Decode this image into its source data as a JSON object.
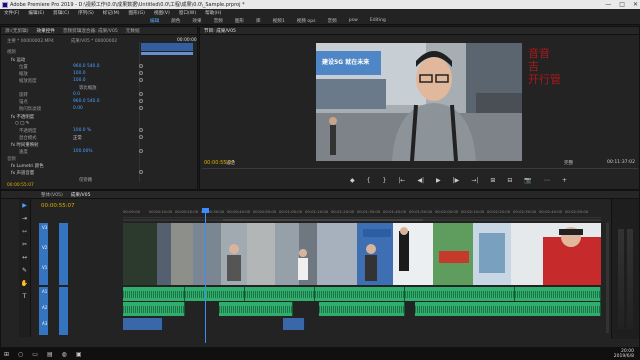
{
  "window": {
    "title": "Adobe Premiere Pro 2019 - D:\\视频工作\\0.0\\成果数据\\Untitled\\0.0\\工程\\成果\\0.0\\_Sample.prproj *",
    "controls": [
      "—",
      "□",
      "✕"
    ]
  },
  "menu": [
    "文件(F)",
    "编辑(E)",
    "剪辑(C)",
    "序列(S)",
    "标记(M)",
    "图形(G)",
    "视图(V)",
    "窗口(W)",
    "帮助(H)"
  ],
  "workspaces": {
    "items": [
      "编辑",
      "颜色",
      "效果",
      "音频",
      "图形",
      "库",
      "视频1",
      "视频 ops",
      "音频",
      "psw",
      "Editing"
    ],
    "active": "编辑"
  },
  "effect_controls": {
    "tabs": [
      "源:(无剪辑)",
      "效果控件",
      "音频剪辑混合器: 成果/V05",
      "元数据"
    ],
    "clip_label": "主要 * 00000002.MP4",
    "seq_label": "成果/V05 * 00000002",
    "timecode": "00:00:00",
    "rows": [
      {
        "label": "视频",
        "value": ""
      },
      {
        "label": "fx 运动",
        "value": ""
      },
      {
        "label": "位置",
        "value": "960.0   540.0"
      },
      {
        "label": "缩放",
        "value": "100.0"
      },
      {
        "label": "缩放宽度",
        "value": "100.0"
      },
      {
        "label": "",
        "value": "等比缩放"
      },
      {
        "label": "旋转",
        "value": "0.0"
      },
      {
        "label": "锚点",
        "value": "960.0   540.0"
      },
      {
        "label": "防闪烁滤镜",
        "value": "0.00"
      },
      {
        "label": "fx 不透明度",
        "value": ""
      },
      {
        "label": "",
        "value": ""
      },
      {
        "label": "不透明度",
        "value": "100.0 %"
      },
      {
        "label": "混合模式",
        "value": "正常"
      },
      {
        "label": "fx 时间重映射",
        "value": ""
      },
      {
        "label": "速度",
        "value": "100.00%"
      },
      {
        "label": "音频",
        "value": ""
      },
      {
        "label": "fx Lumetri 颜色",
        "value": ""
      },
      {
        "label": "fx 声道音量",
        "value": ""
      },
      {
        "label": "",
        "value": "仅旁路"
      }
    ],
    "bottom_timecode": "00:00:55:07"
  },
  "program": {
    "tabs": [
      "节目: 成果/V05"
    ],
    "timecode": "00:00:55:07",
    "fit": "适合",
    "quality": "完整",
    "duration": "00:11:37:02",
    "stage_text": "音音\n吉\n开行管",
    "overlay_banner": "建设5G 就在未来",
    "controls": [
      "◆",
      "{",
      "}",
      "|←",
      "◀|",
      "▶",
      "|▶",
      "→|",
      "⊞",
      "⊟",
      "📷",
      "⋯",
      "+"
    ]
  },
  "timeline": {
    "tabs": [
      "整体(V05)",
      "成果/V05"
    ],
    "timecode": "00:00:55:07",
    "ruler": [
      "00:00:00",
      "00:00:10:00",
      "00:00:20:00",
      "00:00:30:00",
      "00:00:40:00",
      "00:00:50:00",
      "00:01:00:00",
      "00:01:10:00",
      "00:01:20:00",
      "00:01:30:00",
      "00:01:40:00",
      "00:01:50:00",
      "00:02:00:00",
      "00:02:10:00",
      "00:02:20:00",
      "00:02:30:00",
      "00:02:40:00",
      "00:02:50:00",
      "00:03:00:00"
    ],
    "tools": [
      "▶",
      "⇥",
      "⇿",
      "✂",
      "↔",
      "✎",
      "✋",
      "T"
    ],
    "tracks": [
      "V3",
      "V2",
      "V1",
      "A1",
      "A2",
      "A3"
    ]
  },
  "colors": {
    "accent": "#3c8bff",
    "timecode": "#e0b000",
    "audio_clip": "#2fae6e",
    "video_ctl": "#3574c0"
  },
  "taskbar": {
    "time": "20:00",
    "date": "2019/6/8"
  }
}
